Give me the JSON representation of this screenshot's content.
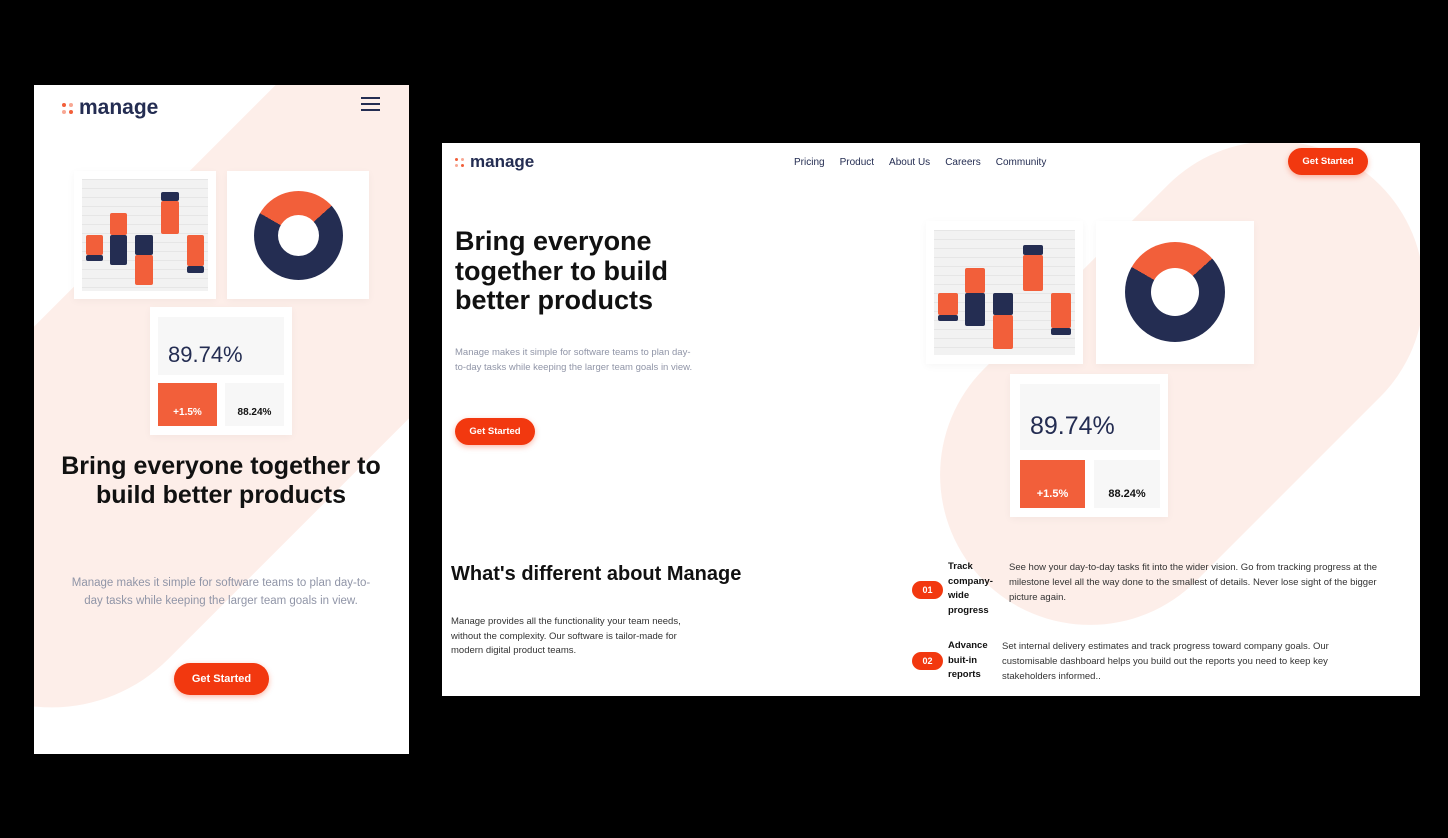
{
  "brand": {
    "name": "manage"
  },
  "mobile": {
    "menu_icon": "hamburger-icon",
    "hero": {
      "title": "Bring everyone together to build better products",
      "subtitle": "Manage makes it simple for software teams to plan day-to-day tasks while keeping the larger team goals in view.",
      "cta": "Get Started"
    }
  },
  "desktop": {
    "nav": [
      "Pricing",
      "Product",
      "About Us",
      "Careers",
      "Community"
    ],
    "header_cta": "Get Started",
    "hero": {
      "title": "Bring everyone together to build better products",
      "subtitle": "Manage makes it simple for software teams to plan day-to-day tasks while keeping the larger team goals in view.",
      "cta": "Get Started"
    },
    "different": {
      "title": "What's different about Manage",
      "text": "Manage provides all the functionality your team needs, without the complexity. Our software is tailor-made for modern digital product teams."
    },
    "features": [
      {
        "num": "01",
        "title": "Track company-wide progress",
        "text": "See how your day-to-day tasks fit into the wider vision. Go from tracking progress at the milestone level all the way done to the smallest of details. Never lose sight of the bigger picture again."
      },
      {
        "num": "02",
        "title": "Advance buit-in reports",
        "text": "Set internal delivery estimates and track progress toward company goals. Our customisable dashboard helps you build out the reports you need to keep key stakeholders informed.."
      }
    ]
  },
  "illustration": {
    "big_stat": "89.74%",
    "change_stat": "+1.5%",
    "small_stat": "88.24%",
    "donut_share_orange": 0.3,
    "colors": {
      "orange": "#f25f3a",
      "navy": "#242d52",
      "cta": "#f2380f"
    }
  }
}
